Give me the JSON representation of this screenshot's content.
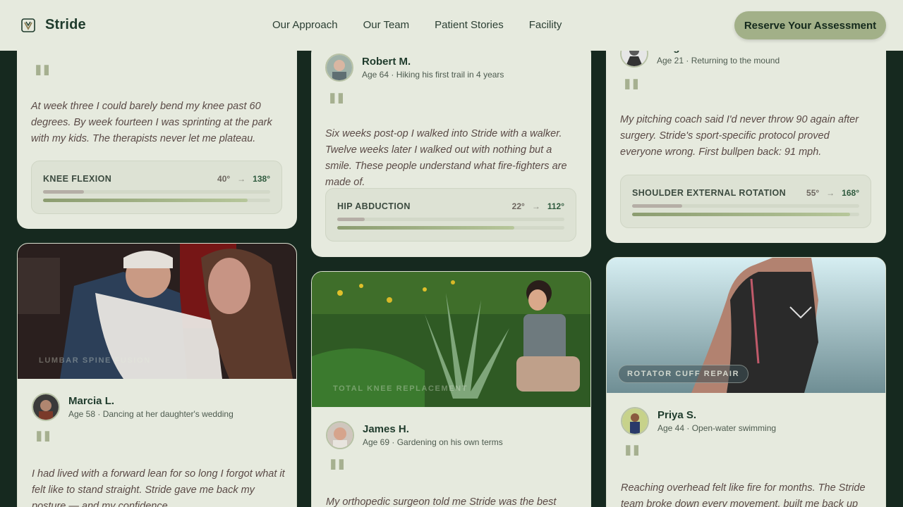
{
  "nav": {
    "brand": "Stride",
    "links": [
      "Our Approach",
      "Our Team",
      "Patient Stories",
      "Facility"
    ],
    "cta": "Reserve Your Assessment"
  },
  "stories": {
    "c1": {
      "quote": "At week three I could barely bend my knee past 60 degrees. By week fourteen I was sprinting at the park with my kids. The therapists never let me plateau.",
      "metric": {
        "label": "Knee Flexion",
        "before": "40°",
        "after": "138°",
        "before_fraction": 0.18,
        "after_fraction": 0.9
      }
    },
    "c2": {
      "name": "Robert M.",
      "meta": "Age 64 · Hiking his first trail in 4 years",
      "quote": "Six weeks post-op I walked into Stride with a walker. Twelve weeks later I walked out with nothing but a smile. These people understand what fire-fighters are made of.",
      "metric": {
        "label": "Hip Abduction",
        "before": "22°",
        "after": "112°",
        "before_fraction": 0.12,
        "after_fraction": 0.78
      }
    },
    "c3": {
      "name": "Diego R.",
      "meta": "Age 21 · Returning to the mound",
      "quote": "My pitching coach said I'd never throw 90 again after surgery. Stride's sport-specific protocol proved everyone wrong. First bullpen back: 91 mph.",
      "metric": {
        "label": "Shoulder External Rotation",
        "before": "55°",
        "after": "168°",
        "before_fraction": 0.22,
        "after_fraction": 0.96
      }
    },
    "c4": {
      "tag": "Lumbar Spine Fusion",
      "name": "Marcia L.",
      "meta": "Age 58 · Dancing at her daughter's wedding",
      "quote": "I had lived with a forward lean for so long I forgot what it felt like to stand straight. Stride gave me back my posture — and my confidence."
    },
    "c5": {
      "tag": "Total Knee Replacement",
      "name": "James H.",
      "meta": "Age 69 · Gardening on his own terms",
      "quote": "My orthopedic surgeon told me Stride was the best rehab"
    },
    "c6": {
      "tag": "Rotator Cuff Repair",
      "name": "Priya S.",
      "meta": "Age 44 · Open-water swimming",
      "quote": "Reaching overhead felt like fire for months. The Stride team broke down every movement, built me back up"
    }
  },
  "colors": {
    "page_bg": "#16291f",
    "card_bg": "#e6eade",
    "accent": "#a2b088",
    "brand": "#1f3b2c"
  }
}
